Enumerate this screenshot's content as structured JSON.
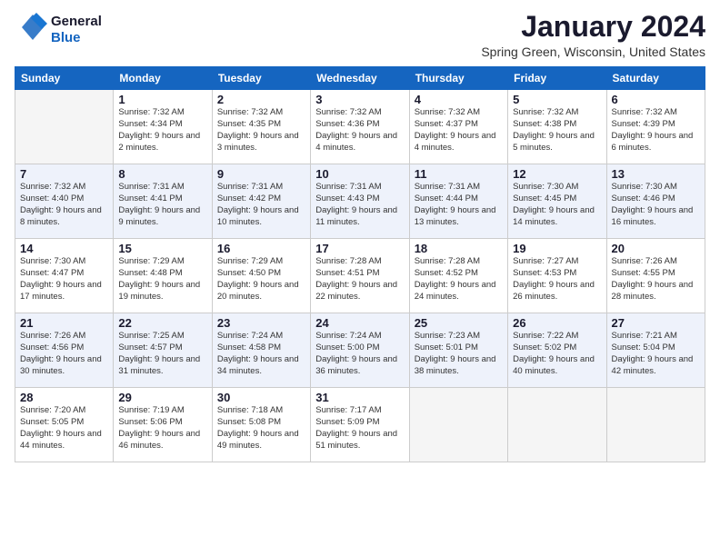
{
  "header": {
    "logo_line1": "General",
    "logo_line2": "Blue",
    "month_title": "January 2024",
    "location": "Spring Green, Wisconsin, United States"
  },
  "weekdays": [
    "Sunday",
    "Monday",
    "Tuesday",
    "Wednesday",
    "Thursday",
    "Friday",
    "Saturday"
  ],
  "weeks": [
    [
      {
        "day": "",
        "sunrise": "",
        "sunset": "",
        "daylight": ""
      },
      {
        "day": "1",
        "sunrise": "Sunrise: 7:32 AM",
        "sunset": "Sunset: 4:34 PM",
        "daylight": "Daylight: 9 hours and 2 minutes."
      },
      {
        "day": "2",
        "sunrise": "Sunrise: 7:32 AM",
        "sunset": "Sunset: 4:35 PM",
        "daylight": "Daylight: 9 hours and 3 minutes."
      },
      {
        "day": "3",
        "sunrise": "Sunrise: 7:32 AM",
        "sunset": "Sunset: 4:36 PM",
        "daylight": "Daylight: 9 hours and 4 minutes."
      },
      {
        "day": "4",
        "sunrise": "Sunrise: 7:32 AM",
        "sunset": "Sunset: 4:37 PM",
        "daylight": "Daylight: 9 hours and 4 minutes."
      },
      {
        "day": "5",
        "sunrise": "Sunrise: 7:32 AM",
        "sunset": "Sunset: 4:38 PM",
        "daylight": "Daylight: 9 hours and 5 minutes."
      },
      {
        "day": "6",
        "sunrise": "Sunrise: 7:32 AM",
        "sunset": "Sunset: 4:39 PM",
        "daylight": "Daylight: 9 hours and 6 minutes."
      }
    ],
    [
      {
        "day": "7",
        "sunrise": "Sunrise: 7:32 AM",
        "sunset": "Sunset: 4:40 PM",
        "daylight": "Daylight: 9 hours and 8 minutes."
      },
      {
        "day": "8",
        "sunrise": "Sunrise: 7:31 AM",
        "sunset": "Sunset: 4:41 PM",
        "daylight": "Daylight: 9 hours and 9 minutes."
      },
      {
        "day": "9",
        "sunrise": "Sunrise: 7:31 AM",
        "sunset": "Sunset: 4:42 PM",
        "daylight": "Daylight: 9 hours and 10 minutes."
      },
      {
        "day": "10",
        "sunrise": "Sunrise: 7:31 AM",
        "sunset": "Sunset: 4:43 PM",
        "daylight": "Daylight: 9 hours and 11 minutes."
      },
      {
        "day": "11",
        "sunrise": "Sunrise: 7:31 AM",
        "sunset": "Sunset: 4:44 PM",
        "daylight": "Daylight: 9 hours and 13 minutes."
      },
      {
        "day": "12",
        "sunrise": "Sunrise: 7:30 AM",
        "sunset": "Sunset: 4:45 PM",
        "daylight": "Daylight: 9 hours and 14 minutes."
      },
      {
        "day": "13",
        "sunrise": "Sunrise: 7:30 AM",
        "sunset": "Sunset: 4:46 PM",
        "daylight": "Daylight: 9 hours and 16 minutes."
      }
    ],
    [
      {
        "day": "14",
        "sunrise": "Sunrise: 7:30 AM",
        "sunset": "Sunset: 4:47 PM",
        "daylight": "Daylight: 9 hours and 17 minutes."
      },
      {
        "day": "15",
        "sunrise": "Sunrise: 7:29 AM",
        "sunset": "Sunset: 4:48 PM",
        "daylight": "Daylight: 9 hours and 19 minutes."
      },
      {
        "day": "16",
        "sunrise": "Sunrise: 7:29 AM",
        "sunset": "Sunset: 4:50 PM",
        "daylight": "Daylight: 9 hours and 20 minutes."
      },
      {
        "day": "17",
        "sunrise": "Sunrise: 7:28 AM",
        "sunset": "Sunset: 4:51 PM",
        "daylight": "Daylight: 9 hours and 22 minutes."
      },
      {
        "day": "18",
        "sunrise": "Sunrise: 7:28 AM",
        "sunset": "Sunset: 4:52 PM",
        "daylight": "Daylight: 9 hours and 24 minutes."
      },
      {
        "day": "19",
        "sunrise": "Sunrise: 7:27 AM",
        "sunset": "Sunset: 4:53 PM",
        "daylight": "Daylight: 9 hours and 26 minutes."
      },
      {
        "day": "20",
        "sunrise": "Sunrise: 7:26 AM",
        "sunset": "Sunset: 4:55 PM",
        "daylight": "Daylight: 9 hours and 28 minutes."
      }
    ],
    [
      {
        "day": "21",
        "sunrise": "Sunrise: 7:26 AM",
        "sunset": "Sunset: 4:56 PM",
        "daylight": "Daylight: 9 hours and 30 minutes."
      },
      {
        "day": "22",
        "sunrise": "Sunrise: 7:25 AM",
        "sunset": "Sunset: 4:57 PM",
        "daylight": "Daylight: 9 hours and 31 minutes."
      },
      {
        "day": "23",
        "sunrise": "Sunrise: 7:24 AM",
        "sunset": "Sunset: 4:58 PM",
        "daylight": "Daylight: 9 hours and 34 minutes."
      },
      {
        "day": "24",
        "sunrise": "Sunrise: 7:24 AM",
        "sunset": "Sunset: 5:00 PM",
        "daylight": "Daylight: 9 hours and 36 minutes."
      },
      {
        "day": "25",
        "sunrise": "Sunrise: 7:23 AM",
        "sunset": "Sunset: 5:01 PM",
        "daylight": "Daylight: 9 hours and 38 minutes."
      },
      {
        "day": "26",
        "sunrise": "Sunrise: 7:22 AM",
        "sunset": "Sunset: 5:02 PM",
        "daylight": "Daylight: 9 hours and 40 minutes."
      },
      {
        "day": "27",
        "sunrise": "Sunrise: 7:21 AM",
        "sunset": "Sunset: 5:04 PM",
        "daylight": "Daylight: 9 hours and 42 minutes."
      }
    ],
    [
      {
        "day": "28",
        "sunrise": "Sunrise: 7:20 AM",
        "sunset": "Sunset: 5:05 PM",
        "daylight": "Daylight: 9 hours and 44 minutes."
      },
      {
        "day": "29",
        "sunrise": "Sunrise: 7:19 AM",
        "sunset": "Sunset: 5:06 PM",
        "daylight": "Daylight: 9 hours and 46 minutes."
      },
      {
        "day": "30",
        "sunrise": "Sunrise: 7:18 AM",
        "sunset": "Sunset: 5:08 PM",
        "daylight": "Daylight: 9 hours and 49 minutes."
      },
      {
        "day": "31",
        "sunrise": "Sunrise: 7:17 AM",
        "sunset": "Sunset: 5:09 PM",
        "daylight": "Daylight: 9 hours and 51 minutes."
      },
      {
        "day": "",
        "sunrise": "",
        "sunset": "",
        "daylight": ""
      },
      {
        "day": "",
        "sunrise": "",
        "sunset": "",
        "daylight": ""
      },
      {
        "day": "",
        "sunrise": "",
        "sunset": "",
        "daylight": ""
      }
    ]
  ]
}
